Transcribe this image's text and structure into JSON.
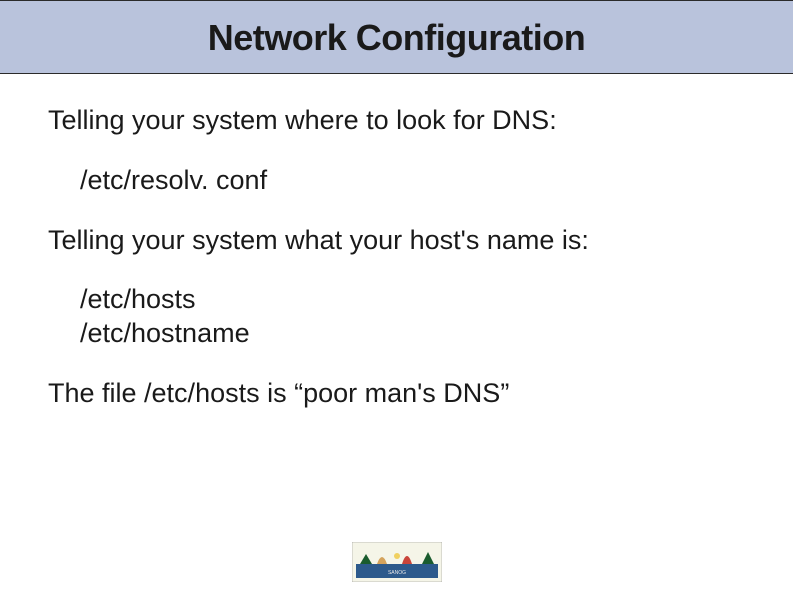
{
  "title": "Network Configuration",
  "lines": {
    "dns_intro": "Telling your system where to look for DNS:",
    "dns_file": "/etc/resolv. conf",
    "host_intro": "Telling your system what your host's name is:",
    "hosts_file": "/etc/hosts",
    "hostname_file": "/etc/hostname",
    "closing": "The file /etc/hosts is “poor man's DNS”"
  }
}
